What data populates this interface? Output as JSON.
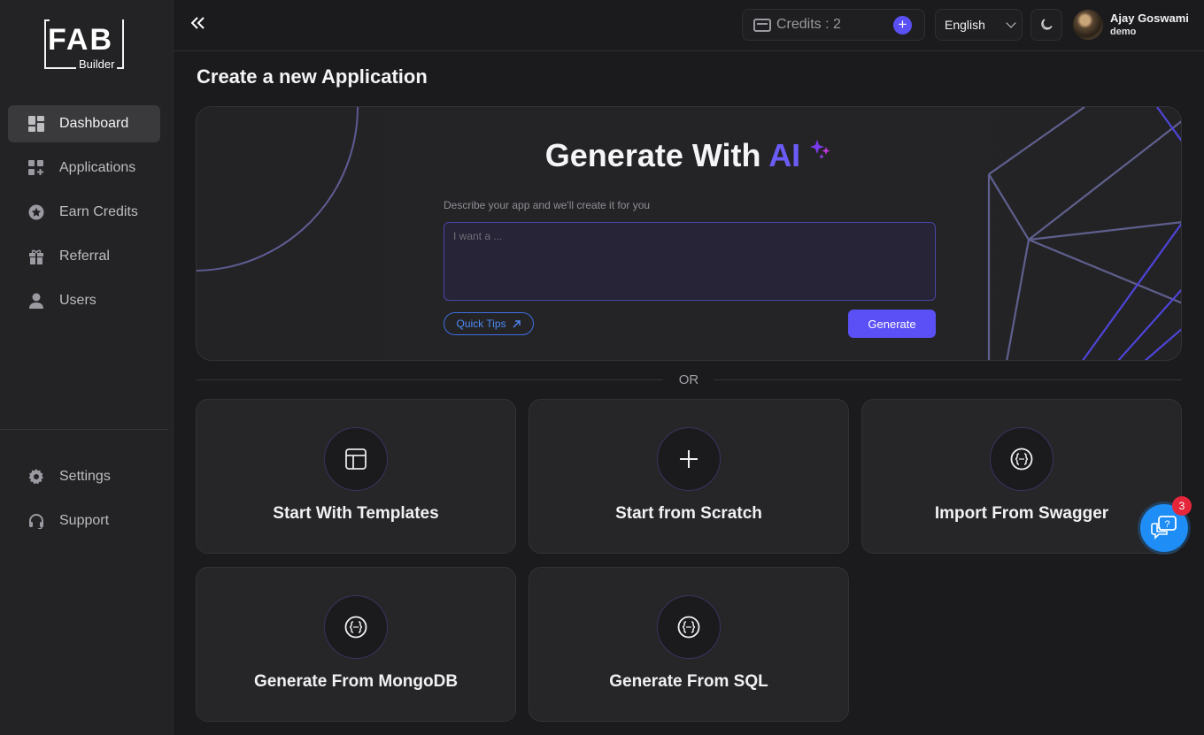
{
  "logo": {
    "main": "FAB",
    "sub": "Builder"
  },
  "sidebar": {
    "items": [
      {
        "label": "Dashboard",
        "icon": "dashboard-icon",
        "active": true
      },
      {
        "label": "Applications",
        "icon": "applications-icon",
        "active": false
      },
      {
        "label": "Earn Credits",
        "icon": "star-icon",
        "active": false
      },
      {
        "label": "Referral",
        "icon": "gift-icon",
        "active": false
      },
      {
        "label": "Users",
        "icon": "user-icon",
        "active": false
      }
    ],
    "bottom_items": [
      {
        "label": "Settings",
        "icon": "gear-icon"
      },
      {
        "label": "Support",
        "icon": "headset-icon"
      }
    ]
  },
  "topbar": {
    "collapse_icon": "double-chevron-left-icon",
    "credits_label": "Credits : 2",
    "language": "English",
    "theme_icon": "moon-icon",
    "user_name": "Ajay Goswami",
    "user_role": "demo"
  },
  "main": {
    "page_title": "Create a new Application",
    "ai": {
      "title_prefix": "Generate With",
      "title_highlight": "AI",
      "description": "Describe your app and we'll create it for you",
      "placeholder": "I want a ...",
      "quick_tips": "Quick Tips",
      "generate": "Generate"
    },
    "or": "OR",
    "cards": [
      {
        "label": "Start With Templates",
        "icon": "template-icon"
      },
      {
        "label": "Start from Scratch",
        "icon": "plus-icon"
      },
      {
        "label": "Import From Swagger",
        "icon": "code-braces-icon"
      },
      {
        "label": "Generate From MongoDB",
        "icon": "code-braces-icon"
      },
      {
        "label": "Generate From SQL",
        "icon": "code-braces-icon"
      }
    ]
  },
  "chat": {
    "badge": "3",
    "icon": "chat-help-icon"
  },
  "colors": {
    "accent": "#5b50f5",
    "ai_highlight": "#6b5cf6",
    "chat": "#1e8df5",
    "badge": "#e5253a"
  }
}
